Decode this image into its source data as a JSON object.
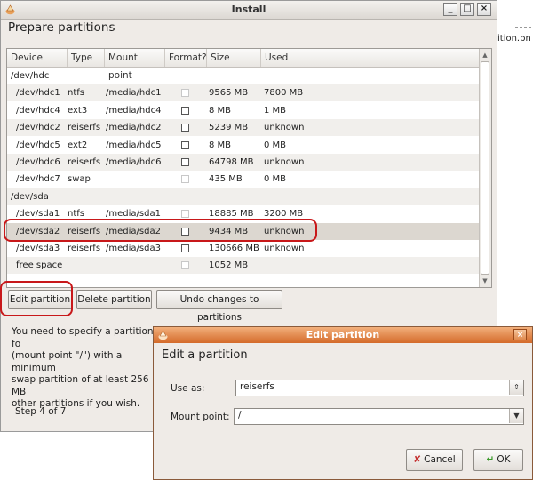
{
  "background": {
    "fragment_text": "ition.pn"
  },
  "window": {
    "title": "Install",
    "minimize": "_",
    "maximize": "□",
    "close": "×"
  },
  "page_title": "Prepare partitions",
  "table": {
    "columns": [
      "Device",
      "Type",
      "Mount point",
      "Format?",
      "Size",
      "Used"
    ],
    "rows": [
      {
        "device": "/dev/hdc",
        "group": true
      },
      {
        "device": "/dev/hdc1",
        "type": "ntfs",
        "mount": "/media/hdc1",
        "format": "disabled",
        "size": "9565 MB",
        "used": "7800 MB"
      },
      {
        "device": "/dev/hdc4",
        "type": "ext3",
        "mount": "/media/hdc4",
        "format": "unchecked",
        "size": "8 MB",
        "used": "1 MB"
      },
      {
        "device": "/dev/hdc2",
        "type": "reiserfs",
        "mount": "/media/hdc2",
        "format": "unchecked",
        "size": "5239 MB",
        "used": "unknown"
      },
      {
        "device": "/dev/hdc5",
        "type": "ext2",
        "mount": "/media/hdc5",
        "format": "unchecked",
        "size": "8 MB",
        "used": "0 MB"
      },
      {
        "device": "/dev/hdc6",
        "type": "reiserfs",
        "mount": "/media/hdc6",
        "format": "unchecked",
        "size": "64798 MB",
        "used": "unknown"
      },
      {
        "device": "/dev/hdc7",
        "type": "swap",
        "mount": "",
        "format": "disabled",
        "size": "435 MB",
        "used": "0 MB"
      },
      {
        "device": "/dev/sda",
        "group": true
      },
      {
        "device": "/dev/sda1",
        "type": "ntfs",
        "mount": "/media/sda1",
        "format": "disabled",
        "size": "18885 MB",
        "used": "3200 MB"
      },
      {
        "device": "/dev/sda2",
        "type": "reiserfs",
        "mount": "/media/sda2",
        "format": "unchecked",
        "size": "9434 MB",
        "used": "unknown",
        "selected": true
      },
      {
        "device": "/dev/sda3",
        "type": "reiserfs",
        "mount": "/media/sda3",
        "format": "unchecked",
        "size": "130666 MB",
        "used": "unknown"
      },
      {
        "device": "free space",
        "type": "",
        "mount": "",
        "format": "disabled",
        "size": "1052 MB",
        "used": ""
      }
    ]
  },
  "buttons": {
    "edit": "Edit partition",
    "delete": "Delete partition",
    "undo": "Undo changes to partitions"
  },
  "note": {
    "line1": "You need to specify a partition fo",
    "line2": "(mount point \"/\") with a minimum",
    "line3": "swap partition of at least 256 MB",
    "line4": "other partitions if you wish."
  },
  "step": "Step 4 of 7",
  "dialog": {
    "title": "Edit partition",
    "close": "×",
    "heading": "Edit a partition",
    "use_as_label": "Use as:",
    "use_as_value": "reiserfs",
    "mount_label": "Mount point:",
    "mount_value": "/",
    "cancel_label": "Cancel",
    "ok_label": "OK"
  },
  "colors": {
    "highlight": "#c8181a",
    "dialog_title": "#d46a2a",
    "selected_row": "#dcd7d0"
  }
}
